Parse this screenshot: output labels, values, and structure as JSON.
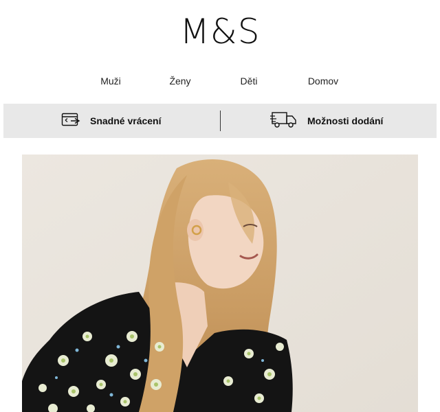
{
  "brand": {
    "logo_text": "M&S"
  },
  "nav": {
    "items": [
      {
        "label": "Muži"
      },
      {
        "label": "Ženy"
      },
      {
        "label": "Děti"
      },
      {
        "label": "Domov"
      }
    ]
  },
  "benefits": {
    "returns": {
      "label": "Snadné vrácení",
      "icon": "return-card-icon"
    },
    "delivery": {
      "label": "Možnosti dodání",
      "icon": "delivery-truck-icon"
    }
  },
  "hero": {
    "colors": {
      "background": "#ebe6df",
      "hair": "#c99b62",
      "skin": "#f0d2bc",
      "dress": "#141414",
      "flower": "#e8ecd2",
      "flower_center": "#a9c46a"
    }
  }
}
